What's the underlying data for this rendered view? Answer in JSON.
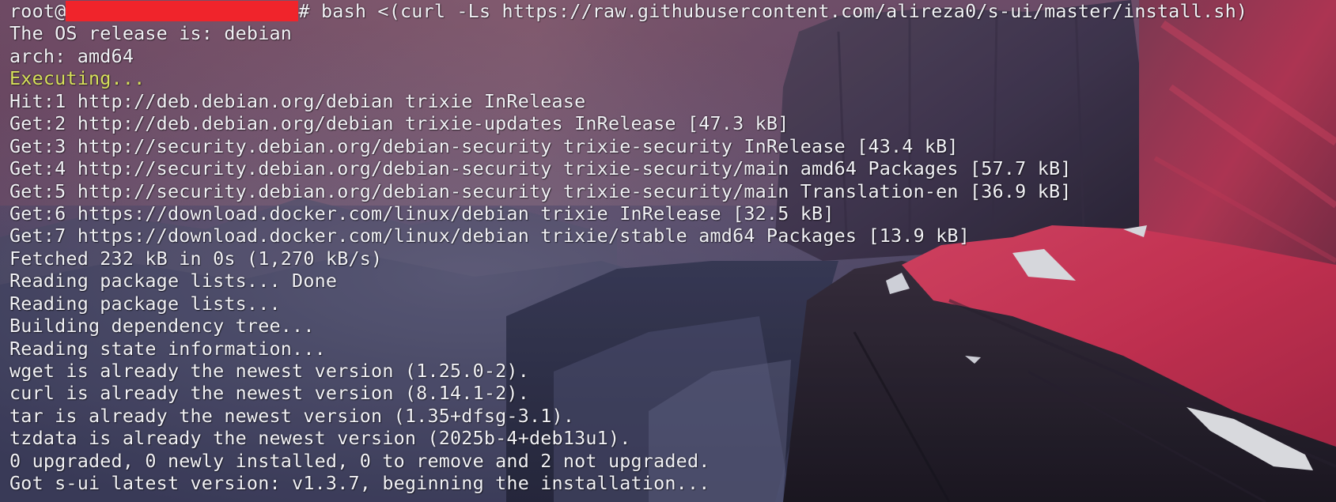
{
  "terminal": {
    "prompt": {
      "user": "root@",
      "redacted": true,
      "suffix": "# ",
      "command": "bash <(curl -Ls https://raw.githubusercontent.com/alireza0/s-ui/master/install.sh)"
    },
    "lines": [
      {
        "text": "The OS release is: debian",
        "color": "#f2f2f6"
      },
      {
        "text": "arch: amd64",
        "color": "#f2f2f6"
      },
      {
        "text": "Executing...",
        "color": "#d6e05a"
      },
      {
        "text": "Hit:1 http://deb.debian.org/debian trixie InRelease",
        "color": "#f2f2f6"
      },
      {
        "text": "Get:2 http://deb.debian.org/debian trixie-updates InRelease [47.3 kB]",
        "color": "#f2f2f6"
      },
      {
        "text": "Get:3 http://security.debian.org/debian-security trixie-security InRelease [43.4 kB]",
        "color": "#f2f2f6"
      },
      {
        "text": "Get:4 http://security.debian.org/debian-security trixie-security/main amd64 Packages [57.7 kB]",
        "color": "#f2f2f6"
      },
      {
        "text": "Get:5 http://security.debian.org/debian-security trixie-security/main Translation-en [36.9 kB]",
        "color": "#f2f2f6"
      },
      {
        "text": "Get:6 https://download.docker.com/linux/debian trixie InRelease [32.5 kB]",
        "color": "#f2f2f6"
      },
      {
        "text": "Get:7 https://download.docker.com/linux/debian trixie/stable amd64 Packages [13.9 kB]",
        "color": "#f2f2f6"
      },
      {
        "text": "Fetched 232 kB in 0s (1,270 kB/s)",
        "color": "#f2f2f6"
      },
      {
        "text": "Reading package lists... Done",
        "color": "#f2f2f6"
      },
      {
        "text": "Reading package lists...",
        "color": "#f2f2f6"
      },
      {
        "text": "Building dependency tree...",
        "color": "#f2f2f6"
      },
      {
        "text": "Reading state information...",
        "color": "#f2f2f6"
      },
      {
        "text": "wget is already the newest version (1.25.0-2).",
        "color": "#f2f2f6"
      },
      {
        "text": "curl is already the newest version (8.14.1-2).",
        "color": "#f2f2f6"
      },
      {
        "text": "tar is already the newest version (1.35+dfsg-3.1).",
        "color": "#f2f2f6"
      },
      {
        "text": "tzdata is already the newest version (2025b-4+deb13u1).",
        "color": "#f2f2f6"
      },
      {
        "text": "0 upgraded, 0 newly installed, 0 to remove and 2 not upgraded.",
        "color": "#f2f2f6"
      },
      {
        "text": "Got s-ui latest version: v1.3.7, beginning the installation...",
        "color": "#f2f2f6"
      }
    ]
  },
  "background": {
    "description_icon": "mountain-landscape-wallpaper",
    "colors": {
      "sky_top": "#6e4a6e",
      "sky_mid": "#8a5f7d",
      "mist": "#4a4a66",
      "peak_red": "#e63a5c",
      "rock_dark": "#2a2434",
      "snow": "#ffffff"
    }
  },
  "redaction_color": "#f0242b"
}
